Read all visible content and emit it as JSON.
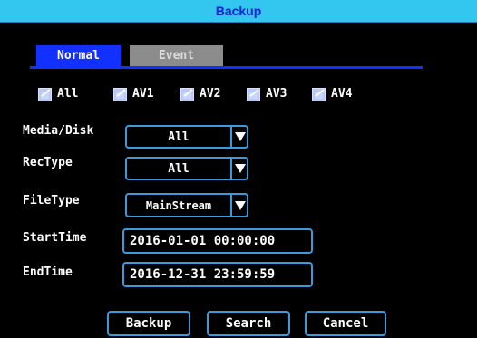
{
  "window": {
    "title": "Backup"
  },
  "tabs": [
    {
      "label": "Normal",
      "active": true
    },
    {
      "label": "Event",
      "active": false
    }
  ],
  "channels": [
    {
      "label": "All",
      "checked": true
    },
    {
      "label": "AV1",
      "checked": true
    },
    {
      "label": "AV2",
      "checked": true
    },
    {
      "label": "AV3",
      "checked": true
    },
    {
      "label": "AV4",
      "checked": true
    }
  ],
  "form": {
    "media_disk": {
      "label": "Media/Disk",
      "value": "All"
    },
    "rec_type": {
      "label": "RecType",
      "value": "All"
    },
    "file_type": {
      "label": "FileType",
      "value": "MainStream"
    },
    "start_time": {
      "label": "StartTime",
      "value": "2016-01-01 00:00:00"
    },
    "end_time": {
      "label": "EndTime",
      "value": "2016-12-31 23:59:59"
    }
  },
  "buttons": {
    "backup": "Backup",
    "search": "Search",
    "cancel": "Cancel"
  },
  "colors": {
    "title_bar": "#33c6ee",
    "accent_blue": "#1230ff",
    "field_border": "#3d9ad8",
    "inactive_tab": "#8c8c8c"
  },
  "icons": {
    "checkbox": "check-icon",
    "dropdown": "triangle-down-icon"
  }
}
